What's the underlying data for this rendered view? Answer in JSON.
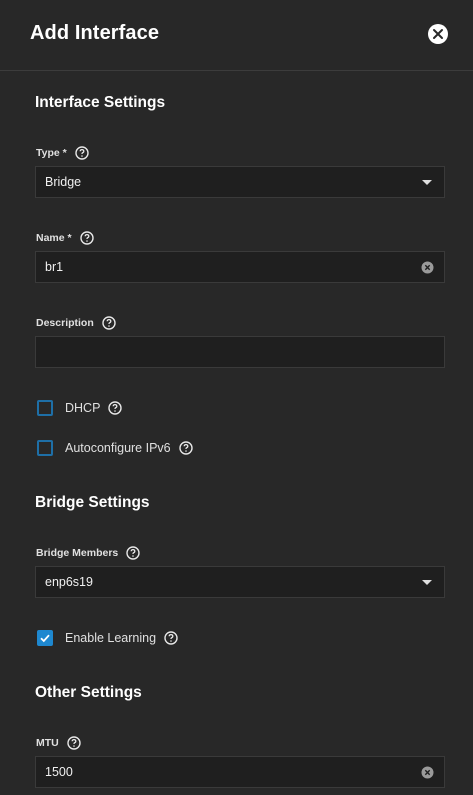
{
  "dialog": {
    "title": "Add Interface",
    "close_icon": "close-icon"
  },
  "interface_settings": {
    "heading": "Interface Settings",
    "type": {
      "label": "Type *",
      "value": "Bridge"
    },
    "name": {
      "label": "Name *",
      "value": "br1"
    },
    "description": {
      "label": "Description",
      "value": ""
    },
    "dhcp": {
      "label": "DHCP",
      "checked": false
    },
    "autoconfigure_ipv6": {
      "label": "Autoconfigure IPv6",
      "checked": false
    }
  },
  "bridge_settings": {
    "heading": "Bridge Settings",
    "bridge_members": {
      "label": "Bridge Members",
      "value": "enp6s19"
    },
    "enable_learning": {
      "label": "Enable Learning",
      "checked": true
    }
  },
  "other_settings": {
    "heading": "Other Settings",
    "mtu": {
      "label": "MTU",
      "value": "1500"
    }
  },
  "colors": {
    "background": "#282828",
    "input_background": "#1f1f1f",
    "accent": "#1e88d0"
  }
}
